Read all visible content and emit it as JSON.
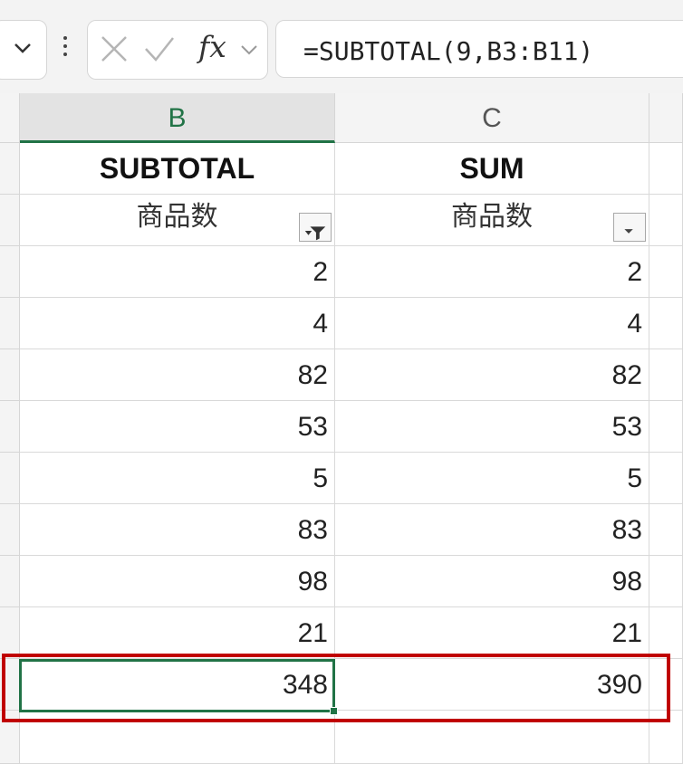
{
  "formula_bar": {
    "name_box_icon": "chevron-down-icon",
    "more_icon": "vertical-ellipsis-icon",
    "cancel_icon": "x-icon",
    "enter_icon": "checkmark-icon",
    "fx_label": "fx",
    "formula": "=SUBTOTAL(9,B3:B11)"
  },
  "columns": [
    {
      "letter": "B",
      "selected": true
    },
    {
      "letter": "C",
      "selected": false
    }
  ],
  "header_row": {
    "b": "SUBTOTAL",
    "c": "SUM"
  },
  "label_row": {
    "b": "商品数",
    "c": "商品数",
    "b_filter_active": true,
    "c_filter_active": false
  },
  "data_rows": [
    {
      "b": "2",
      "c": "2"
    },
    {
      "b": "4",
      "c": "4"
    },
    {
      "b": "82",
      "c": "82"
    },
    {
      "b": "53",
      "c": "53"
    },
    {
      "b": "5",
      "c": "5"
    },
    {
      "b": "83",
      "c": "83"
    },
    {
      "b": "98",
      "c": "98"
    },
    {
      "b": "21",
      "c": "21"
    }
  ],
  "total_row": {
    "b": "348",
    "c": "390"
  },
  "colors": {
    "selection_green": "#217346",
    "highlight_red": "#c00000"
  }
}
